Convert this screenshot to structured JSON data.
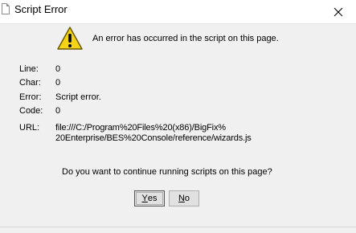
{
  "window": {
    "title": "Script Error"
  },
  "message": "An error has occurred in the script on this page.",
  "fields": {
    "line_label": "Line:",
    "line_value": "0",
    "char_label": "Char:",
    "char_value": "0",
    "error_label": "Error:",
    "error_value": "Script error.",
    "code_label": "Code:",
    "code_value": "0",
    "url_label": "URL:",
    "url_line1": "file:///C:/Program%20Files%20(x86)/BigFix%",
    "url_line2": "20Enterprise/BES%20Console/reference/wizards.js"
  },
  "question": "Do you want to continue running scripts on this page?",
  "buttons": {
    "yes_mnemonic": "Y",
    "yes_rest": "es",
    "no_mnemonic": "N",
    "no_rest": "o"
  },
  "icons": {
    "title": "document-icon",
    "close": "close-icon",
    "warning": "warning-icon"
  },
  "colors": {
    "warning_fill": "#f5d316",
    "dialog_bg": "#f0f0f0"
  }
}
